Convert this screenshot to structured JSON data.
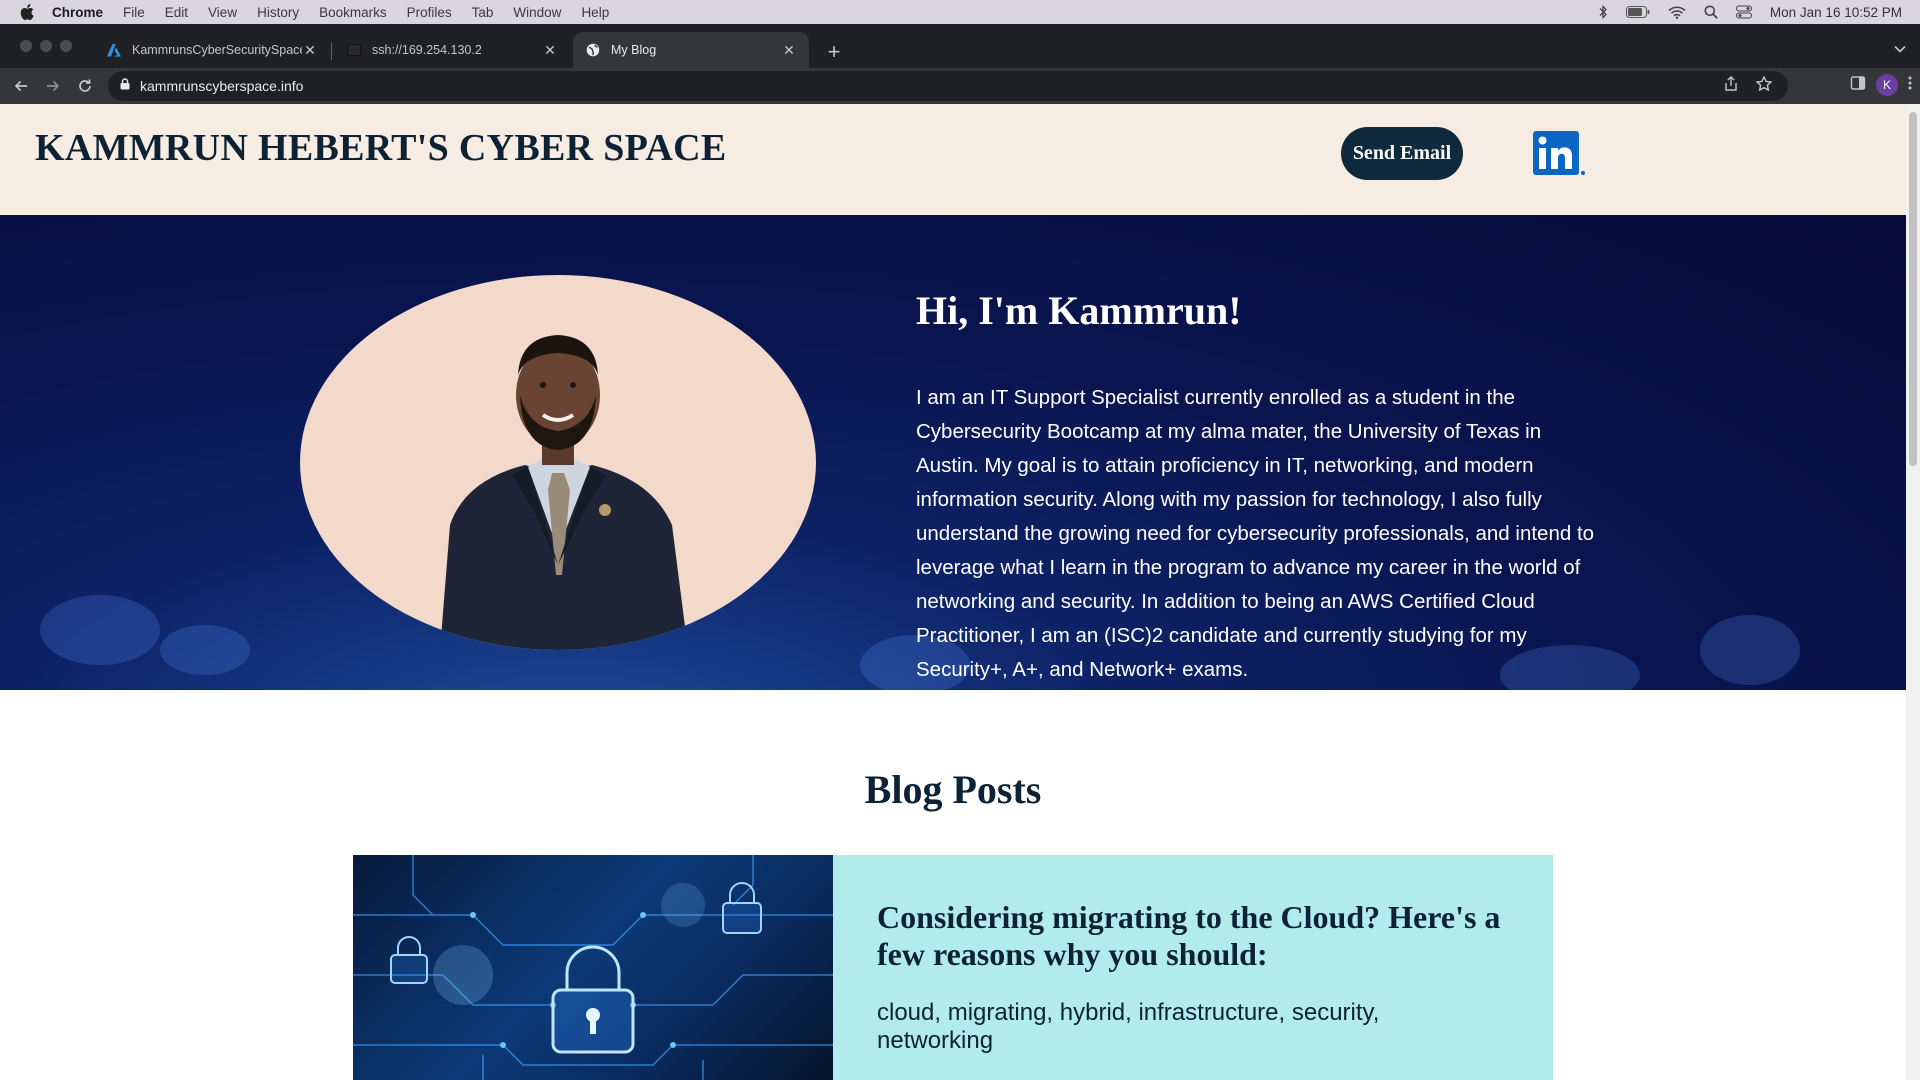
{
  "menubar": {
    "app": "Chrome",
    "items": [
      "File",
      "Edit",
      "View",
      "History",
      "Bookmarks",
      "Profiles",
      "Tab",
      "Window",
      "Help"
    ],
    "datetime": "Mon Jan 16  10:52 PM"
  },
  "tabs": [
    {
      "title": "KammrunsCyberSecuritySpace",
      "favicon": "azure-icon"
    },
    {
      "title": "ssh://169.254.130.2",
      "favicon": "terminal-icon"
    },
    {
      "title": "My Blog",
      "favicon": "globe-icon",
      "active": true
    }
  ],
  "toolbar": {
    "url": "kammrunscyberspace.info",
    "profile_initial": "K"
  },
  "site": {
    "title": "KAMMRUN HEBERT'S CYBER SPACE",
    "email_button": "Send Email",
    "linkedin_label": "in",
    "brand_color": "#0f2a3d",
    "header_bg": "#f6ece2"
  },
  "hero": {
    "title": "Hi, I'm Kammrun!",
    "bio": "I am an IT Support Specialist currently enrolled as a student in the Cybersecurity Bootcamp at my alma mater, the University of Texas in Austin. My goal is to attain proficiency in IT, networking, and modern information security. Along with my passion for technology, I also fully understand the growing need for cybersecurity professionals, and intend to leverage what I learn in the program to advance my career in the world of networking and security. In addition to being an AWS Certified Cloud Practitioner, I am an (ISC)2 candidate and currently studying for my Security+, A+, and Network+ exams."
  },
  "blog": {
    "heading": "Blog Posts",
    "posts": [
      {
        "title": "Considering migrating to the Cloud? Here's a few reasons why you should:",
        "tags": "cloud, migrating, hybrid, infrastructure, security, networking",
        "card_bg": "#b2ebec"
      }
    ]
  }
}
